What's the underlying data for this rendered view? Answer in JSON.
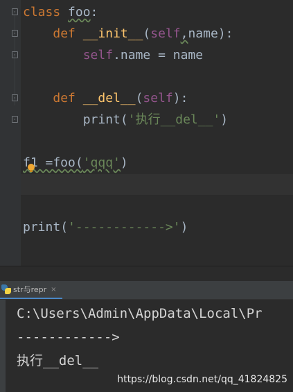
{
  "editor": {
    "lines": [
      {
        "tokens": [
          {
            "t": "class",
            "c": "kw"
          },
          {
            "t": " ",
            "c": "plain"
          },
          {
            "t": "foo",
            "c": "plain wavy"
          },
          {
            "t": ":",
            "c": "plain"
          }
        ]
      },
      {
        "tokens": [
          {
            "t": "    ",
            "c": "plain"
          },
          {
            "t": "def",
            "c": "kw"
          },
          {
            "t": " ",
            "c": "plain"
          },
          {
            "t": "__init__",
            "c": "fn"
          },
          {
            "t": "(",
            "c": "plain"
          },
          {
            "t": "self",
            "c": "selfc"
          },
          {
            "t": ",",
            "c": "plain wavy"
          },
          {
            "t": "name",
            "c": "plain"
          },
          {
            "t": "):",
            "c": "plain"
          }
        ]
      },
      {
        "tokens": [
          {
            "t": "        ",
            "c": "plain"
          },
          {
            "t": "self",
            "c": "selfc"
          },
          {
            "t": ".name = name",
            "c": "plain"
          }
        ]
      },
      {
        "tokens": []
      },
      {
        "tokens": [
          {
            "t": "    ",
            "c": "plain"
          },
          {
            "t": "def",
            "c": "kw"
          },
          {
            "t": " ",
            "c": "plain"
          },
          {
            "t": "__del__",
            "c": "fn"
          },
          {
            "t": "(",
            "c": "plain"
          },
          {
            "t": "self",
            "c": "selfc"
          },
          {
            "t": "):",
            "c": "plain"
          }
        ]
      },
      {
        "tokens": [
          {
            "t": "        ",
            "c": "plain"
          },
          {
            "t": "print",
            "c": "plain"
          },
          {
            "t": "(",
            "c": "plain"
          },
          {
            "t": "'执行__del__'",
            "c": "str"
          },
          {
            "t": ")",
            "c": "plain"
          }
        ]
      },
      {
        "tokens": []
      },
      {
        "tokens": [
          {
            "t": "f1 =foo(",
            "c": "plain wavy"
          },
          {
            "t": "'qqq'",
            "c": "str wavy"
          },
          {
            "t": ")",
            "c": "plain"
          }
        ]
      },
      {
        "tokens": []
      },
      {
        "tokens": []
      },
      {
        "tokens": [
          {
            "t": "print",
            "c": "plain"
          },
          {
            "t": "(",
            "c": "plain"
          },
          {
            "t": "'------------>'",
            "c": "str"
          },
          {
            "t": ")",
            "c": "plain"
          }
        ]
      }
    ]
  },
  "run_panel": {
    "tab_label": "str与repr",
    "close_glyph": "×",
    "output_lines": [
      "C:\\Users\\Admin\\AppData\\Local\\Pr",
      "------------>",
      "执行__del__"
    ]
  },
  "watermark": "https://blog.csdn.net/qq_41824825"
}
